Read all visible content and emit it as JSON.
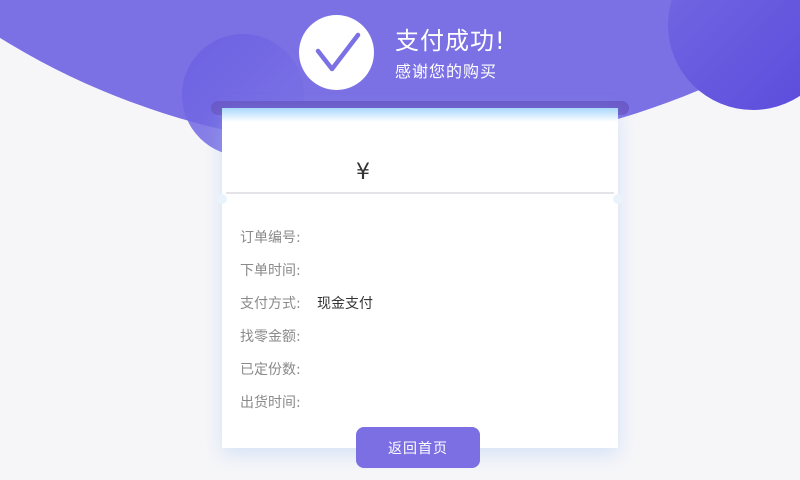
{
  "header": {
    "title": "支付成功!",
    "subtitle": "感谢您的购买",
    "icon": "checkmark-icon"
  },
  "receipt": {
    "amount_text": "¥",
    "fields": [
      {
        "label": "订单编号:",
        "value": ""
      },
      {
        "label": "下单时间:",
        "value": ""
      },
      {
        "label": "支付方式:",
        "value": "现金支付"
      },
      {
        "label": "找零金额:",
        "value": ""
      },
      {
        "label": "已定份数:",
        "value": ""
      },
      {
        "label": "出货时间:",
        "value": ""
      }
    ]
  },
  "actions": {
    "home_label": "返回首页"
  },
  "colors": {
    "accent": "#7b71e4",
    "accent_dark": "#5c4ddc",
    "background": "#f6f6f9"
  }
}
